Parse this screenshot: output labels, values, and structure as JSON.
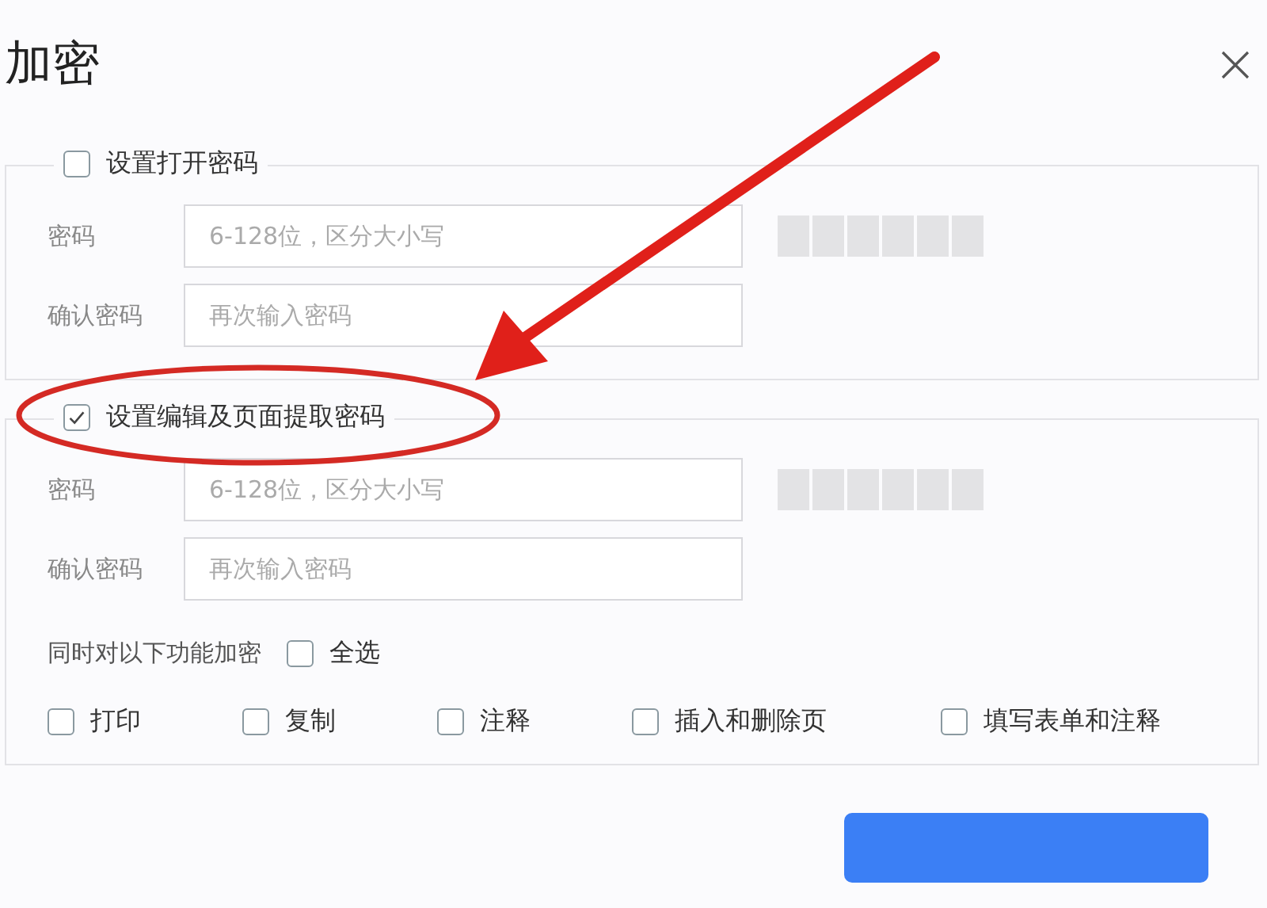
{
  "window": {
    "title": "加密"
  },
  "sections": [
    {
      "label": "设置打开密码",
      "checked": false,
      "fields": [
        {
          "label": "密码",
          "placeholder": "6-128位，区分大小写",
          "strength": true
        },
        {
          "label": "确认密码",
          "placeholder": "再次输入密码",
          "strength": false
        }
      ]
    },
    {
      "label": "设置编辑及页面提取密码",
      "checked": true,
      "fields": [
        {
          "label": "密码",
          "placeholder": "6-128位，区分大小写",
          "strength": true
        },
        {
          "label": "确认密码",
          "placeholder": "再次输入密码",
          "strength": false
        }
      ],
      "permissions": {
        "label": "同时对以下功能加密",
        "select_all": {
          "label": "全选",
          "checked": false
        },
        "options": [
          {
            "label": "打印",
            "checked": false
          },
          {
            "label": "复制",
            "checked": false
          },
          {
            "label": "注释",
            "checked": false
          },
          {
            "label": "插入和删除页",
            "checked": false
          },
          {
            "label": "填写表单和注释",
            "checked": false
          }
        ]
      }
    }
  ]
}
